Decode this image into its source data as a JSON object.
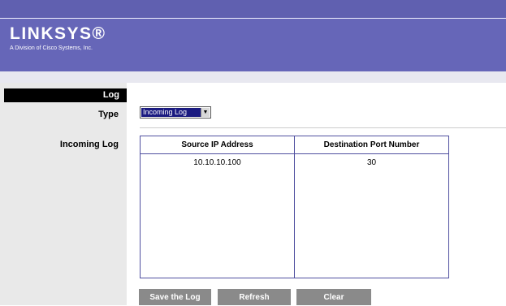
{
  "header": {
    "logo_text": "LINKSYS®",
    "tagline": "A Division of Cisco Systems, Inc."
  },
  "sidebar": {
    "section_title": "Log",
    "type_label": "Type",
    "incoming_label": "Incoming Log"
  },
  "type_select": {
    "value": "Incoming Log"
  },
  "log_table": {
    "columns": [
      "Source IP Address",
      "Destination Port Number"
    ],
    "rows": [
      [
        "10.10.10.100",
        "30"
      ]
    ]
  },
  "buttons": {
    "save": "Save the Log",
    "refresh": "Refresh",
    "clear": "Clear"
  },
  "colors": {
    "header": "#6666b8",
    "sidebar": "#e9e9e9",
    "table_border": "#5050a0",
    "button": "#8a8a8a"
  },
  "icons": {
    "select_arrow": "chevron-down-icon"
  }
}
